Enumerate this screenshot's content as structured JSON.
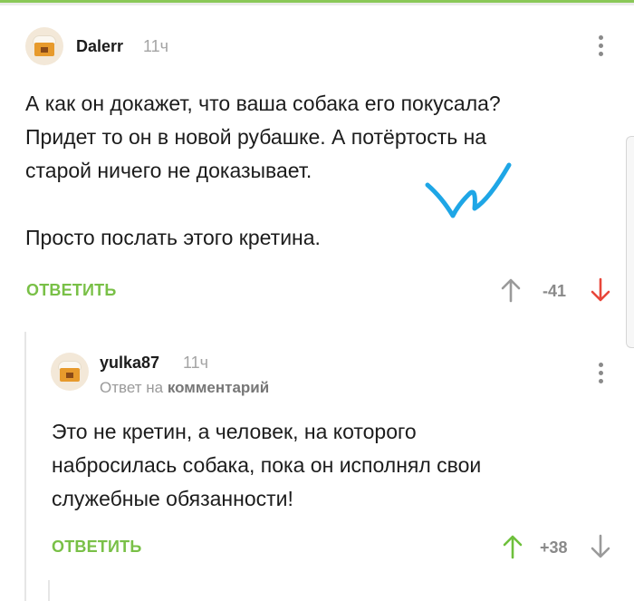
{
  "comments": [
    {
      "author": "Dalerr",
      "time": "11ч",
      "text_lines": [
        "А как он докажет, что ваша собака его покусала?",
        "Придет то он в новой рубашке. А потёртость на",
        "старой ничего не доказывает.",
        "",
        "Просто послать этого кретина."
      ],
      "reply_label": "ОТВЕТИТЬ",
      "rating": "-41",
      "vote_state": "down"
    },
    {
      "author": "yulka87",
      "time": "11ч",
      "reply_to_prefix": "Ответ на",
      "reply_to_link": "комментарий",
      "text_lines": [
        "Это не кретин, а человек, на которого",
        "набросилась собака, пока он исполнял свои",
        "служебные обязанности!"
      ],
      "reply_label": "ОТВЕТИТЬ",
      "rating": "+38",
      "vote_state": "up"
    }
  ],
  "colors": {
    "accent_green": "#79c047",
    "downvote_red": "#e8463a",
    "upvote_green": "#6ec03c",
    "neutral_gray": "#9a9a9a",
    "scribble_blue": "#1ea6e6"
  },
  "icons": [
    "avatar-cake-icon",
    "more-vert-icon",
    "arrow-up-icon",
    "arrow-down-icon"
  ]
}
